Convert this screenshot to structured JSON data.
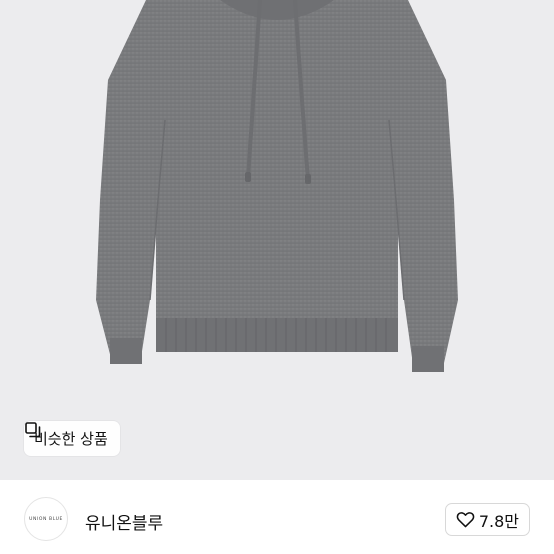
{
  "product": {
    "image_alt": "grey knit hoodie",
    "similar_label": "비슷한 상품",
    "similar_icon": "similar-items-icon"
  },
  "brand": {
    "logo_text": "UNION BLUE",
    "name": "유니온블루"
  },
  "like": {
    "icon": "heart-icon",
    "count": "7.8만"
  },
  "colors": {
    "hero_bg": "#ececee",
    "sweater": "#7a7b7d"
  }
}
